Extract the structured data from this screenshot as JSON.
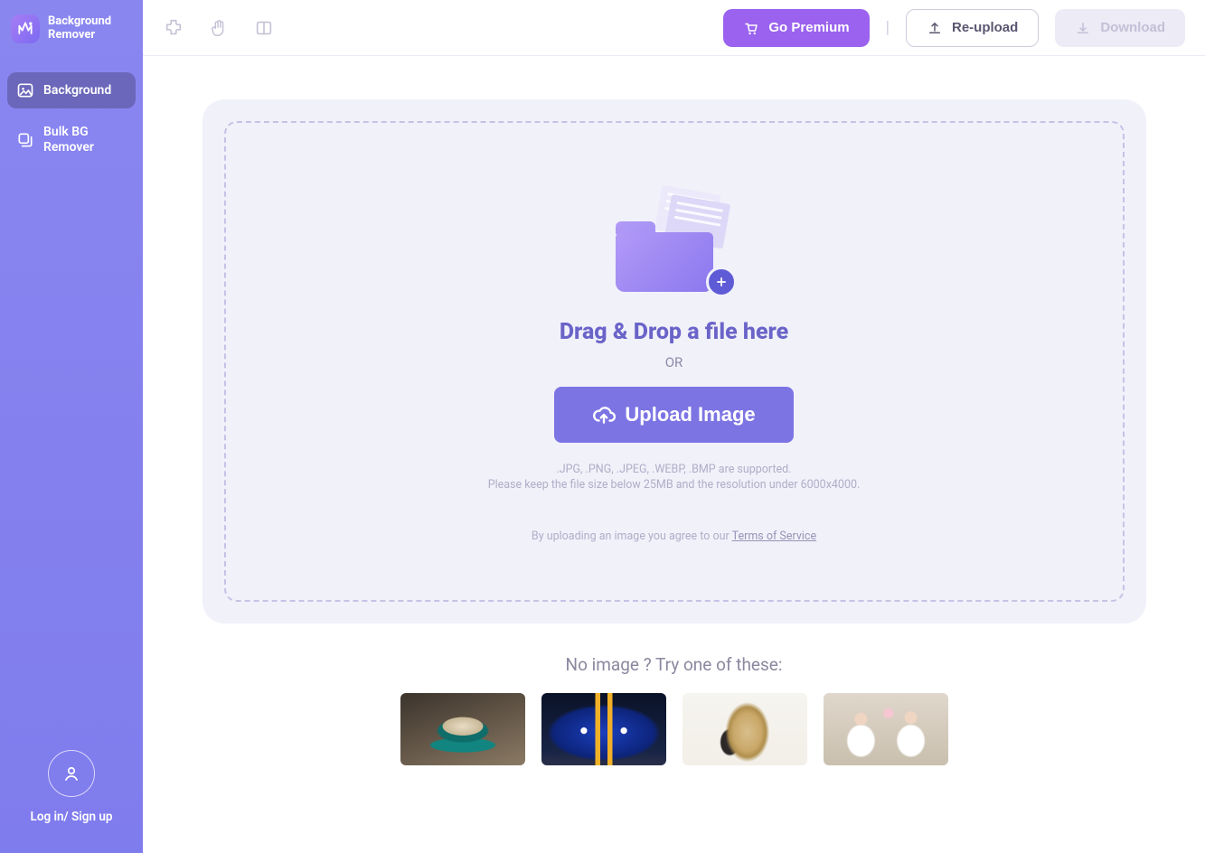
{
  "brand": {
    "line1": "Background",
    "line2": "Remover"
  },
  "sidebar": {
    "items": [
      {
        "label": "Background"
      },
      {
        "label": "Bulk BG\nRemover"
      }
    ],
    "login_label": "Log in/ Sign up"
  },
  "topbar": {
    "go_premium": "Go Premium",
    "reupload": "Re-upload",
    "download": "Download"
  },
  "upload": {
    "title": "Drag & Drop a file here",
    "or": "OR",
    "button": "Upload Image",
    "hint1": ".JPG, .PNG, .JPEG, .WEBP, .BMP are supported.",
    "hint2": "Please keep the file size below 25MB and the resolution under 6000x4000.",
    "tos_prefix": "By uploading an image you agree to our ",
    "tos_link": "Terms of Service"
  },
  "samples": {
    "title": "No image ? Try one of these:",
    "items": [
      "coffee cup",
      "blue sports car",
      "woman with hair",
      "family"
    ]
  }
}
